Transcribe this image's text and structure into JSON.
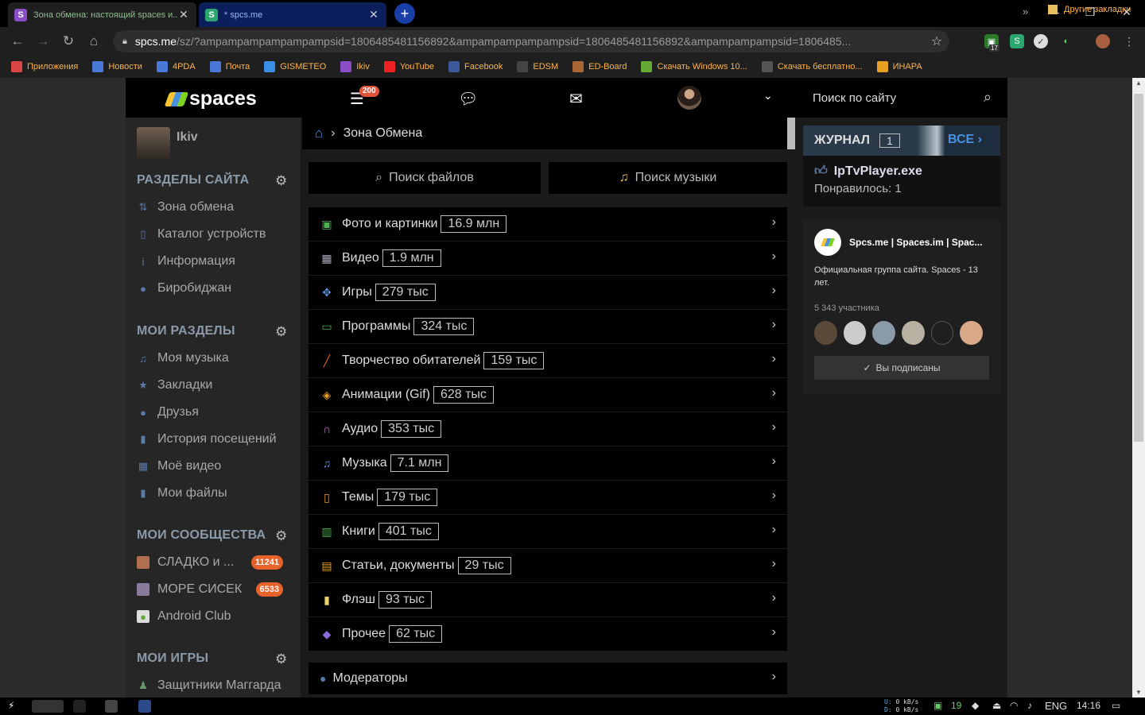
{
  "browser": {
    "tabs": [
      {
        "title": "Зона обмена: настоящий spaces и...",
        "favicon": "S",
        "color": "#8a4cc7",
        "active": true
      },
      {
        "title": "* spcs.me",
        "favicon": "S",
        "color": "#2ca66f",
        "active": false
      }
    ],
    "new_tab": "+",
    "url_host": "spcs.me",
    "url_path": "/sz/?ampampampampampampsid=1806485481156892&ampampampampampsid=1806485481156892&ampampampampsid=1806485...",
    "ext_badge": "17",
    "bookmarks": [
      {
        "label": "Приложения",
        "color": "#d44"
      },
      {
        "label": "Новости",
        "color": "#4a78d8"
      },
      {
        "label": "4PDA",
        "color": "#4a78d8"
      },
      {
        "label": "Почта",
        "color": "#4a78d8"
      },
      {
        "label": "GISMETEO",
        "color": "#3a8ee6"
      },
      {
        "label": "Ikiv",
        "color": "#8a4cc7"
      },
      {
        "label": "YouTube",
        "color": "#e22"
      },
      {
        "label": "Facebook",
        "color": "#3b5998"
      },
      {
        "label": "EDSM",
        "color": "#444"
      },
      {
        "label": "ED-Board",
        "color": "#a63"
      },
      {
        "label": "Скачать Windows 10...",
        "color": "#6a3"
      },
      {
        "label": "Скачать бесплатно...",
        "color": "#555"
      },
      {
        "label": "ИНАРА",
        "color": "#e8a020"
      }
    ],
    "bookmarks_more": "»",
    "other_bookmarks": "Другие закладки"
  },
  "site": {
    "logo": "spaces",
    "notif_badge": "200",
    "search_placeholder": "Поиск по сайту"
  },
  "sidebar": {
    "username": "Ikiv",
    "sections": {
      "site": "РАЗДЕЛЫ САЙТА",
      "mine": "МОИ РАЗДЕЛЫ",
      "communities": "МОИ СООБЩЕСТВА",
      "games": "МОИ ИГРЫ"
    },
    "site_items": [
      "Зона обмена",
      "Каталог устройств",
      "Информация",
      "Биробиджан"
    ],
    "my_items": [
      "Моя музыка",
      "Закладки",
      "Друзья",
      "История посещений",
      "Моё видео",
      "Мои файлы"
    ],
    "communities": [
      {
        "label": "СЛАДКО и ...",
        "badge": "11241"
      },
      {
        "label": "МОРЕ СИСЕК",
        "badge": "6533"
      },
      {
        "label": "Android Club",
        "badge": ""
      }
    ],
    "games": [
      "Защитники Маггарда"
    ]
  },
  "main": {
    "breadcrumb": "Зона Обмена",
    "search_files": "Поиск файлов",
    "search_music": "Поиск музыки",
    "categories": [
      {
        "label": "Фото и картинки",
        "count": "16.9 млн",
        "icon": "image-icon",
        "color": "#4caf50",
        "glyph": "▣"
      },
      {
        "label": "Видео",
        "count": "1.9 млн",
        "icon": "film-icon",
        "color": "#aab",
        "glyph": "▦"
      },
      {
        "label": "Игры",
        "count": "279 тыс",
        "icon": "gamepad-icon",
        "color": "#5a8fd8",
        "glyph": "✥"
      },
      {
        "label": "Программы",
        "count": "324 тыс",
        "icon": "monitor-icon",
        "color": "#4caf50",
        "glyph": "▭"
      },
      {
        "label": "Творчество обитателей",
        "count": "159 тыс",
        "icon": "brush-icon",
        "color": "#e8622c",
        "glyph": "╱"
      },
      {
        "label": "Анимации (Gif)",
        "count": "628 тыс",
        "icon": "gif-icon",
        "color": "#e8a020",
        "glyph": "◈"
      },
      {
        "label": "Аудио",
        "count": "353 тыс",
        "icon": "headphones-icon",
        "color": "#d070d0",
        "glyph": "∩"
      },
      {
        "label": "Музыка",
        "count": "7.1 млн",
        "icon": "music-note-icon",
        "color": "#5a8fd8",
        "glyph": "♫"
      },
      {
        "label": "Темы",
        "count": "179 тыс",
        "icon": "phone-icon",
        "color": "#e8a020",
        "glyph": "▯"
      },
      {
        "label": "Книги",
        "count": "401 тыс",
        "icon": "book-icon",
        "color": "#4caf50",
        "glyph": "▥"
      },
      {
        "label": "Статьи, документы",
        "count": "29 тыс",
        "icon": "scroll-icon",
        "color": "#e8a020",
        "glyph": "▤"
      },
      {
        "label": "Флэш",
        "count": "93 тыс",
        "icon": "file-icon",
        "color": "#e8d070",
        "glyph": "▮"
      },
      {
        "label": "Прочее",
        "count": "62 тыс",
        "icon": "tag-icon",
        "color": "#8a6ad8",
        "glyph": "◆"
      }
    ],
    "moderators": "Модераторы"
  },
  "journal": {
    "title": "ЖУРНАЛ",
    "count": "1",
    "all": "ВСЕ",
    "file": "IpTvPlayer.exe",
    "liked": "Понравилось: 1"
  },
  "group": {
    "name": "Spcs.me | Spaces.im | Spac...",
    "description": "Официальная группа сайта. Spaces - 13 лет.",
    "members": "5 343 участника",
    "subscribed": "Вы подписаны"
  },
  "taskbar": {
    "net_up_label": "U:",
    "net_down_label": "D:",
    "net_up": "0 kB/s",
    "net_down": "0 kB/s",
    "tray_num": "19",
    "lang": "ENG",
    "time": "14:16"
  }
}
